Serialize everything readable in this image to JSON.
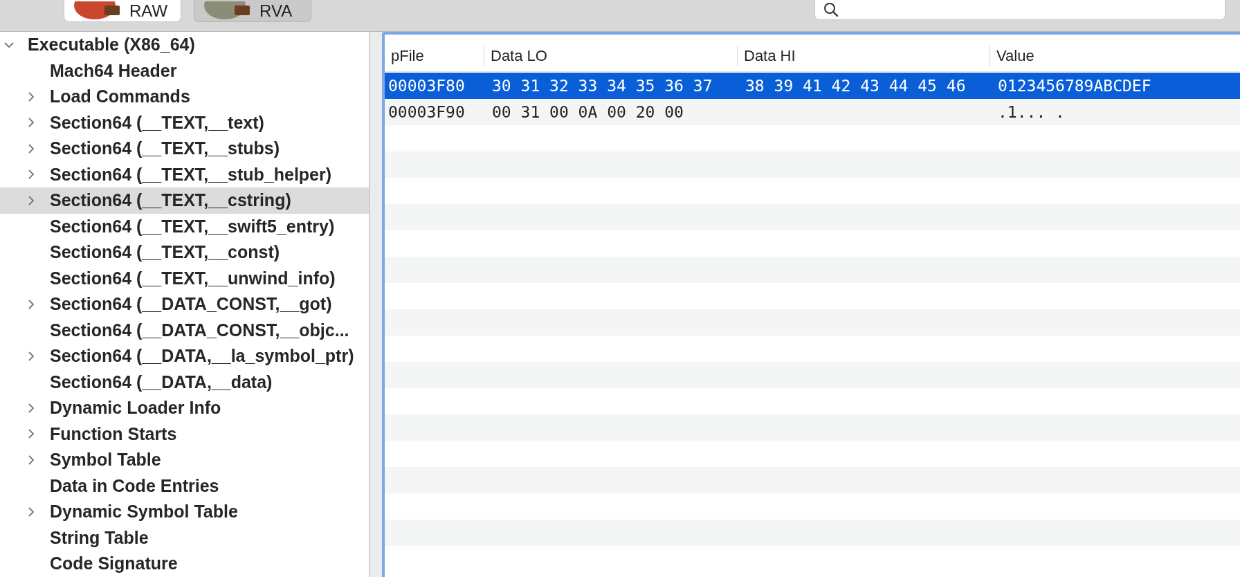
{
  "toolbar": {
    "modes": [
      {
        "label": "RAW",
        "selected": true
      },
      {
        "label": "RVA",
        "selected": false
      }
    ]
  },
  "tree": [
    {
      "label": "Executable  (X86_64)",
      "expanded": true,
      "selected": false,
      "children": [
        {
          "label": "Mach64 Header",
          "selected": false
        },
        {
          "label": "Load Commands",
          "expanded": false,
          "selected": false
        },
        {
          "label": "Section64 (__TEXT,__text)",
          "expanded": false,
          "selected": false
        },
        {
          "label": "Section64 (__TEXT,__stubs)",
          "expanded": false,
          "selected": false
        },
        {
          "label": "Section64 (__TEXT,__stub_helper)",
          "expanded": false,
          "selected": false
        },
        {
          "label": "Section64 (__TEXT,__cstring)",
          "expanded": false,
          "selected": true
        },
        {
          "label": "Section64 (__TEXT,__swift5_entry)",
          "selected": false
        },
        {
          "label": "Section64 (__TEXT,__const)",
          "selected": false
        },
        {
          "label": "Section64 (__TEXT,__unwind_info)",
          "selected": false
        },
        {
          "label": "Section64 (__DATA_CONST,__got)",
          "expanded": false,
          "selected": false
        },
        {
          "label": "Section64 (__DATA_CONST,__objc...",
          "selected": false
        },
        {
          "label": "Section64 (__DATA,__la_symbol_ptr)",
          "expanded": false,
          "selected": false
        },
        {
          "label": "Section64 (__DATA,__data)",
          "selected": false
        },
        {
          "label": "Dynamic Loader Info",
          "expanded": false,
          "selected": false
        },
        {
          "label": "Function Starts",
          "expanded": false,
          "selected": false
        },
        {
          "label": "Symbol Table",
          "expanded": false,
          "selected": false
        },
        {
          "label": "Data in Code Entries",
          "selected": false
        },
        {
          "label": "Dynamic Symbol Table",
          "expanded": false,
          "selected": false
        },
        {
          "label": "String Table",
          "selected": false
        },
        {
          "label": "Code Signature",
          "selected": false
        }
      ]
    }
  ],
  "table": {
    "columns": [
      "pFile",
      "Data LO",
      "Data HI",
      "Value"
    ],
    "rows": [
      {
        "cells": [
          "00003F80",
          "30 31 32 33 34 35 36 37",
          "38 39 41 42 43 44 45 46",
          "0123456789ABCDEF"
        ],
        "selected": true
      },
      {
        "cells": [
          "00003F90",
          "00 31 00 0A 00 20 00",
          "",
          ".1... ."
        ],
        "selected": false
      }
    ]
  }
}
